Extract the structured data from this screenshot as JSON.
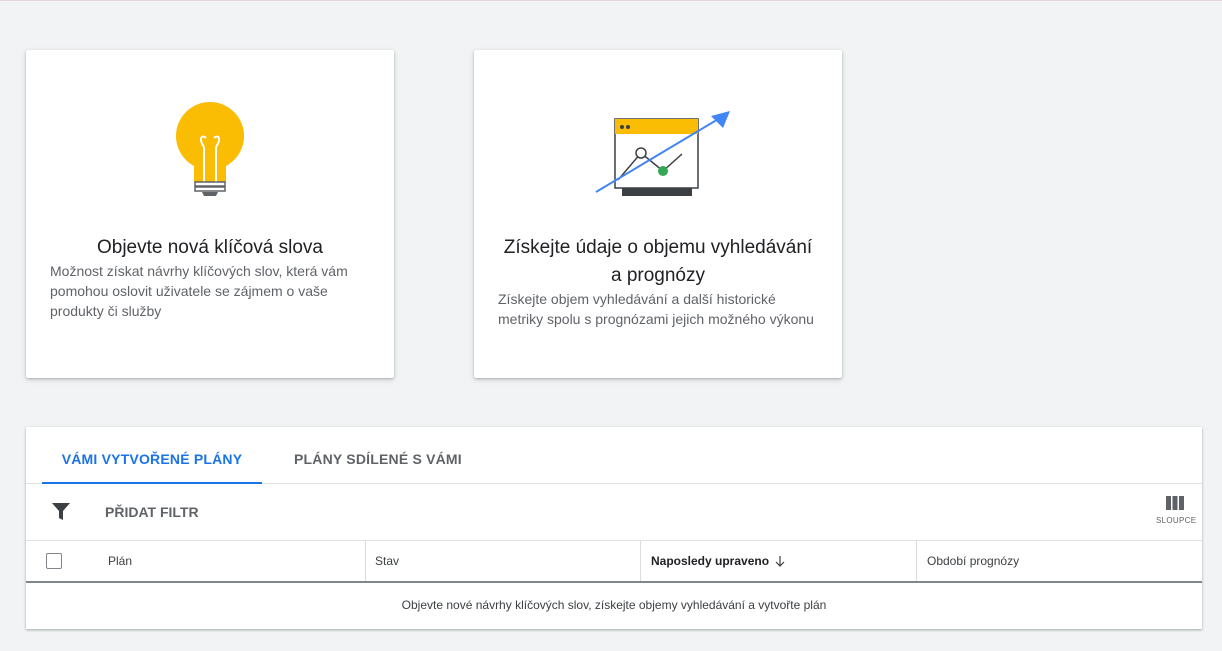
{
  "cards": [
    {
      "title": "Objevte nová klíčová slova",
      "description": "Možnost získat návrhy klíčových slov, která vám pomohou oslovit uživatele se zájmem o vaše produkty či služby",
      "icon": "lightbulb-icon"
    },
    {
      "title": "Získejte údaje o objemu vyhledávání a prognózy",
      "description": "Získejte objem vyhledávání a další historické metriky spolu s prognózami jejich možného výkonu",
      "icon": "trend-chart-icon"
    }
  ],
  "tabs": [
    {
      "label": "VÁMI VYTVOŘENÉ PLÁNY",
      "active": true
    },
    {
      "label": "PLÁNY SDÍLENÉ S VÁMI",
      "active": false
    }
  ],
  "toolbar": {
    "add_filter_label": "PŘIDAT FILTR",
    "columns_label": "SLOUPCE"
  },
  "table": {
    "columns": [
      "Plán",
      "Stav",
      "Naposledy upraveno",
      "Období prognózy"
    ],
    "sorted_column": "Naposledy upraveno",
    "sort_direction": "descending",
    "empty_message": "Objevte nové návrhy klíčových slov, získejte objemy vyhledávání a vytvořte plán"
  },
  "colors": {
    "accent": "#1a73e8",
    "bulb_yellow": "#fbbc04",
    "chart_green": "#34a853",
    "arrow_blue": "#4285f4"
  }
}
